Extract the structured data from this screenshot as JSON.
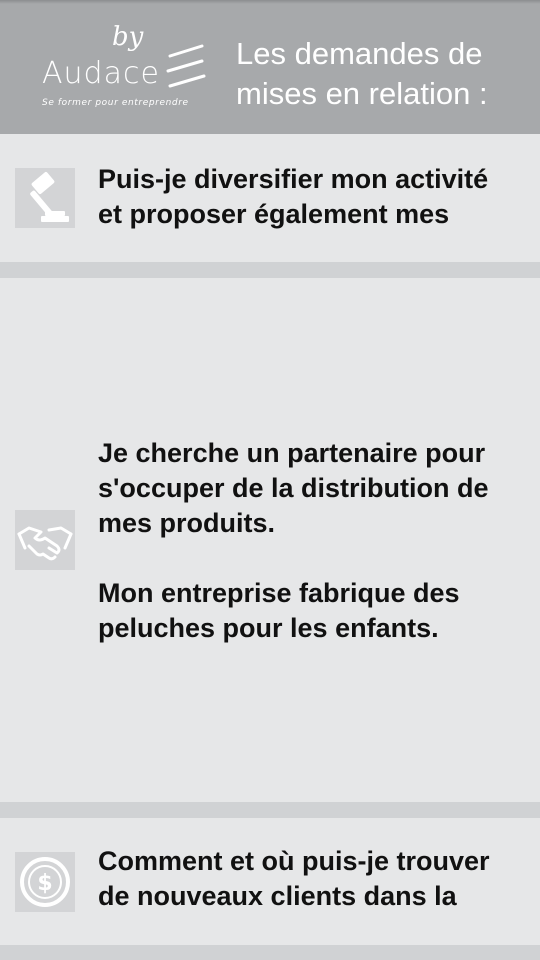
{
  "header": {
    "logo": {
      "by": "by",
      "wordmark": "Audace",
      "tagline": "Se former pour entreprendre"
    },
    "title": "Les demandes de mises en relation :"
  },
  "cards": [
    {
      "icon": "gavel-icon",
      "text": "Puis-je diversifier mon activité et proposer également mes"
    },
    {
      "icon": "handshake-icon",
      "text": "Je cherche un partenaire pour s'occuper de la distribution de mes produits.\n\nMon entreprise fabrique des peluches pour les enfants."
    },
    {
      "icon": "dollar-coin-icon",
      "text": "Comment et où puis-je trouver de nouveaux clients dans la"
    }
  ],
  "colors": {
    "header_bg": "#a7a9ab",
    "card_bg": "#e6e7e8",
    "separator": "#d0d2d4",
    "icon_bg": "#d3d4d6",
    "text": "#111111"
  }
}
